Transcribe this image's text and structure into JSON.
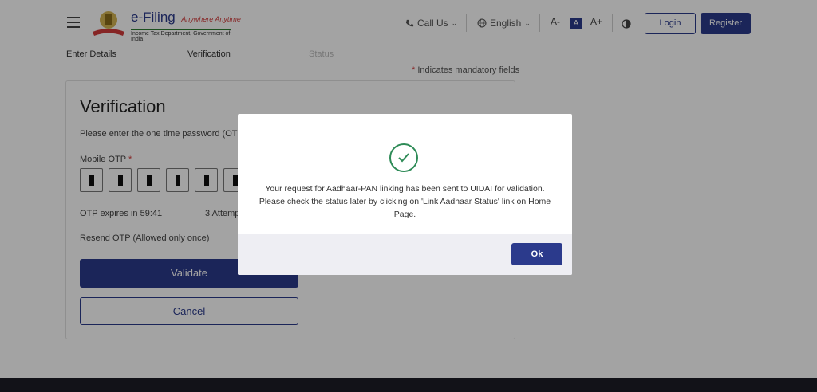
{
  "header": {
    "logo_main": "e-Filing",
    "logo_tagline": "Anywhere Anytime",
    "logo_subtitle": "Income Tax Department, Government of India",
    "call_us": "Call Us",
    "language": "English",
    "font_decrease": "A-",
    "font_default": "A",
    "font_increase": "A+",
    "login_label": "Login",
    "register_label": "Register"
  },
  "steps": {
    "step1": "Enter Details",
    "step2": "Verification",
    "step3": "Status"
  },
  "mandatory_note": "Indicates mandatory fields",
  "form": {
    "title": "Verification",
    "description": "Please enter the one time password (OTP)",
    "otp_label": "Mobile OTP",
    "otp_expires": "OTP expires in 59:41",
    "attempts": "3 Attemp",
    "resend": "Resend OTP  (Allowed only once)",
    "validate_label": "Validate",
    "cancel_label": "Cancel"
  },
  "modal": {
    "message_line1": "Your request for Aadhaar-PAN linking has been sent to UIDAI for validation.",
    "message_line2": "Please check the status later by clicking on 'Link Aadhaar Status' link on Home Page.",
    "ok_label": "Ok"
  },
  "colors": {
    "primary": "#2b3a8c",
    "success": "#2e8b57",
    "required": "#d23a3a"
  }
}
